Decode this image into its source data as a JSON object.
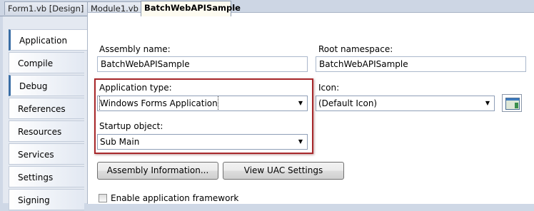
{
  "tabs": [
    {
      "label": "Form1.vb [Design]"
    },
    {
      "label": "Module1.vb"
    },
    {
      "label": "BatchWebAPISample"
    }
  ],
  "sidebar": {
    "items": [
      {
        "label": "Application"
      },
      {
        "label": "Compile"
      },
      {
        "label": "Debug"
      },
      {
        "label": "References"
      },
      {
        "label": "Resources"
      },
      {
        "label": "Services"
      },
      {
        "label": "Settings"
      },
      {
        "label": "Signing"
      }
    ]
  },
  "form": {
    "assembly_name_label": "Assembly name:",
    "assembly_name_value": "BatchWebAPISample",
    "root_namespace_label": "Root namespace:",
    "root_namespace_value": "BatchWebAPISample",
    "application_type_label": "Application type:",
    "application_type_value": "Windows Forms Application",
    "icon_label": "Icon:",
    "icon_value": "(Default Icon)",
    "startup_object_label": "Startup object:",
    "startup_object_value": "Sub Main",
    "assembly_info_button": "Assembly Information...",
    "uac_button": "View UAC Settings",
    "enable_framework_label": "Enable application framework",
    "enable_framework_checked": false
  },
  "colors": {
    "highlight_border": "#a8282b",
    "active_tab_accent": "#3a6ea5"
  },
  "icons": {
    "dropdown": "chevron-down-icon",
    "icon_preview": "window-icon"
  }
}
